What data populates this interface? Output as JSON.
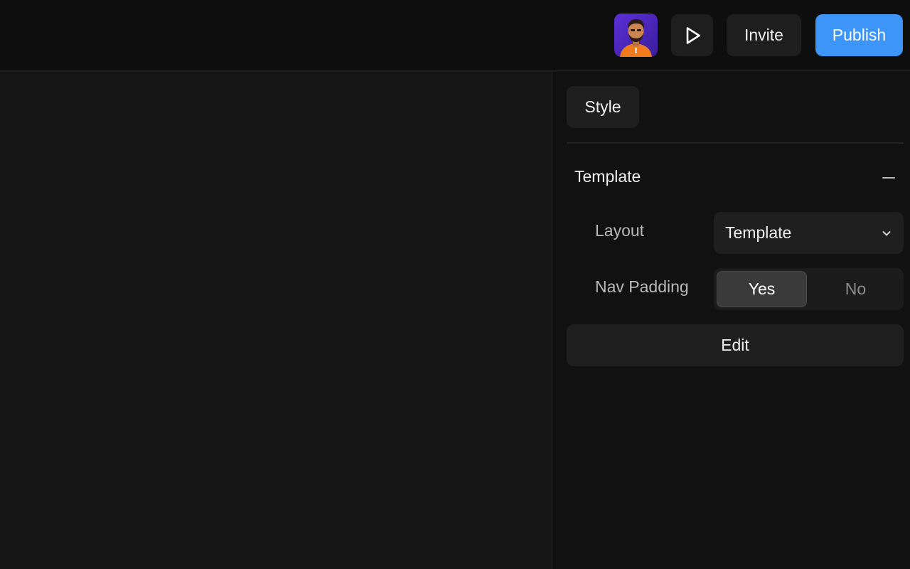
{
  "header": {
    "avatar_icon": "user-avatar",
    "play_icon": "play-icon",
    "invite_label": "Invite",
    "publish_label": "Publish",
    "publish_color": "#3d95f7"
  },
  "panel": {
    "style_tab_label": "Style",
    "section": {
      "title": "Template",
      "collapse_icon": "minus-icon"
    },
    "layout": {
      "label": "Layout",
      "selected_value": "Template",
      "dropdown_icon": "chevron-down-icon"
    },
    "nav_padding": {
      "label": "Nav Padding",
      "options": [
        "Yes",
        "No"
      ],
      "selected": "Yes"
    },
    "edit_label": "Edit"
  }
}
